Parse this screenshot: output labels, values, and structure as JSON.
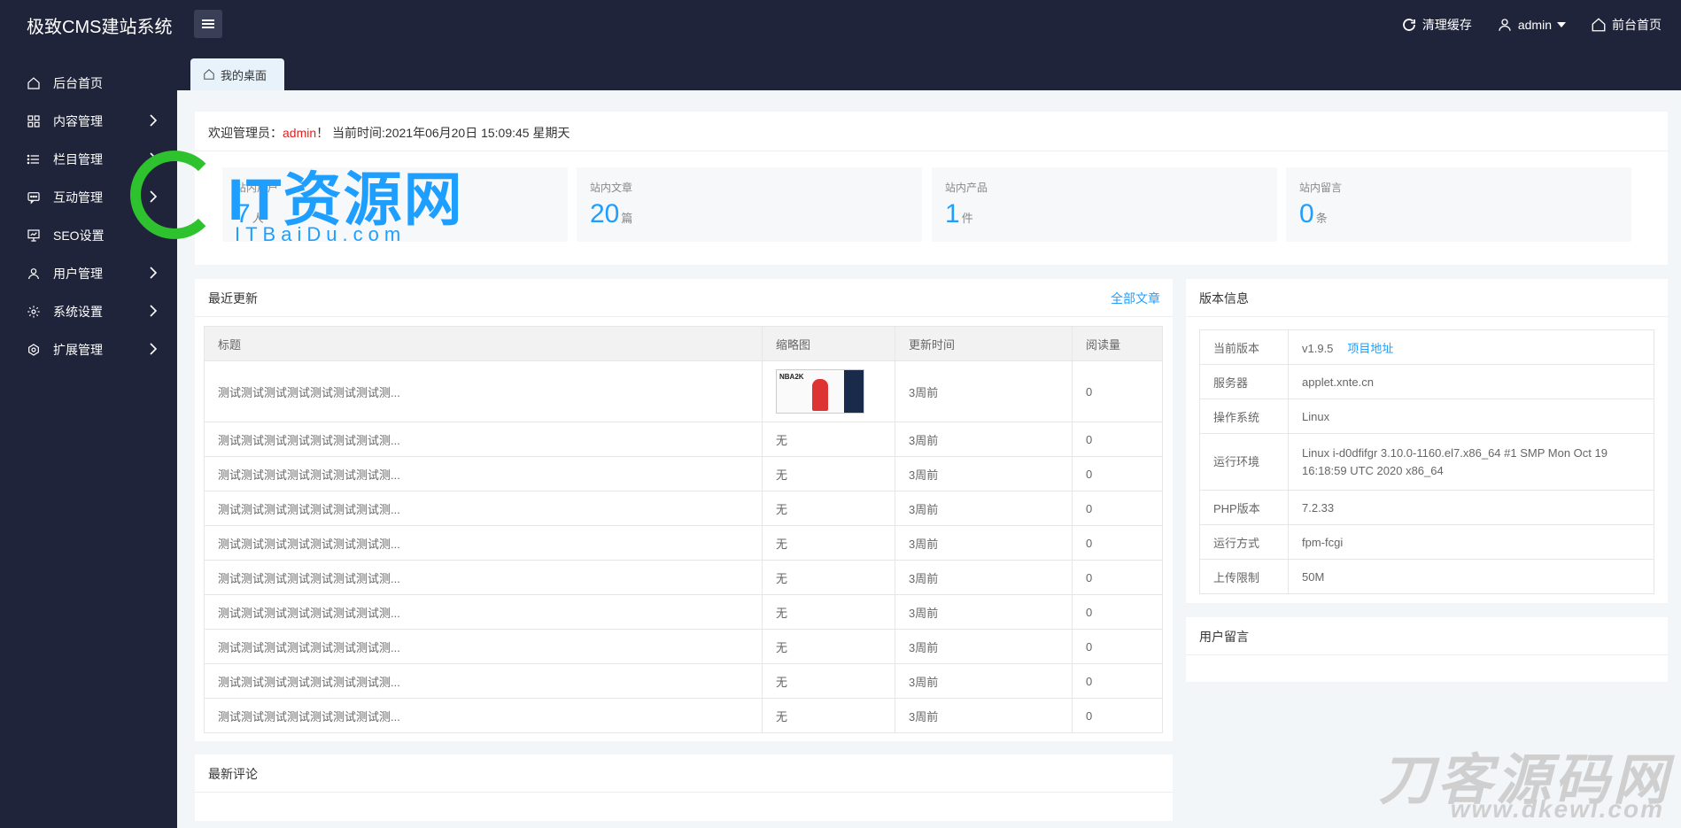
{
  "app": {
    "title": "极致CMS建站系统"
  },
  "header": {
    "clear_cache": "清理缓存",
    "user": "admin",
    "frontend": "前台首页"
  },
  "sidebar": {
    "items": [
      {
        "label": "后台首页",
        "icon": "home-icon",
        "has_children": false
      },
      {
        "label": "内容管理",
        "icon": "grid-icon",
        "has_children": true
      },
      {
        "label": "栏目管理",
        "icon": "list-icon",
        "has_children": true
      },
      {
        "label": "互动管理",
        "icon": "chat-icon",
        "has_children": true
      },
      {
        "label": "SEO设置",
        "icon": "seo-icon",
        "has_children": false
      },
      {
        "label": "用户管理",
        "icon": "user-icon",
        "has_children": true
      },
      {
        "label": "系统设置",
        "icon": "gear-icon",
        "has_children": true
      },
      {
        "label": "扩展管理",
        "icon": "extension-icon",
        "has_children": true
      }
    ]
  },
  "tabs": {
    "active": "我的桌面"
  },
  "welcome": {
    "prefix": "欢迎管理员：",
    "user": "admin",
    "suffix": "！ 当前时间:2021年06月20日 15:09:45 星期天"
  },
  "stats": [
    {
      "label": "站内用户",
      "value": "7",
      "unit": "人"
    },
    {
      "label": "站内文章",
      "value": "20",
      "unit": "篇"
    },
    {
      "label": "站内产品",
      "value": "1",
      "unit": "件"
    },
    {
      "label": "站内留言",
      "value": "0",
      "unit": "条"
    }
  ],
  "recent": {
    "title": "最近更新",
    "more": "全部文章",
    "columns": [
      "标题",
      "缩略图",
      "更新时间",
      "阅读量"
    ],
    "rows": [
      {
        "title": "测试测试测试测试测试测试测试测...",
        "thumb": "image",
        "time": "3周前",
        "views": "0"
      },
      {
        "title": "测试测试测试测试测试测试测试测...",
        "thumb": "无",
        "time": "3周前",
        "views": "0"
      },
      {
        "title": "测试测试测试测试测试测试测试测...",
        "thumb": "无",
        "time": "3周前",
        "views": "0"
      },
      {
        "title": "测试测试测试测试测试测试测试测...",
        "thumb": "无",
        "time": "3周前",
        "views": "0"
      },
      {
        "title": "测试测试测试测试测试测试测试测...",
        "thumb": "无",
        "time": "3周前",
        "views": "0"
      },
      {
        "title": "测试测试测试测试测试测试测试测...",
        "thumb": "无",
        "time": "3周前",
        "views": "0"
      },
      {
        "title": "测试测试测试测试测试测试测试测...",
        "thumb": "无",
        "time": "3周前",
        "views": "0"
      },
      {
        "title": "测试测试测试测试测试测试测试测...",
        "thumb": "无",
        "time": "3周前",
        "views": "0"
      },
      {
        "title": "测试测试测试测试测试测试测试测...",
        "thumb": "无",
        "time": "3周前",
        "views": "0"
      },
      {
        "title": "测试测试测试测试测试测试测试测...",
        "thumb": "无",
        "time": "3周前",
        "views": "0"
      }
    ]
  },
  "version": {
    "title": "版本信息",
    "link": "项目地址",
    "rows": [
      {
        "key": "当前版本",
        "value": "v1.9.5"
      },
      {
        "key": "服务器",
        "value": "applet.xnte.cn"
      },
      {
        "key": "操作系统",
        "value": "Linux"
      },
      {
        "key": "运行环境",
        "value": "Linux i-d0dfifgr 3.10.0-1160.el7.x86_64 #1 SMP Mon Oct 19 16:18:59 UTC 2020 x86_64"
      },
      {
        "key": "PHP版本",
        "value": "7.2.33"
      },
      {
        "key": "运行方式",
        "value": "fpm-fcgi"
      },
      {
        "key": "上传限制",
        "value": "50M"
      }
    ]
  },
  "messages": {
    "title": "用户留言"
  },
  "comments": {
    "title": "最新评论"
  },
  "watermarks": {
    "site1_name": "IT资源网",
    "site1_domain": "ITBaiDu.com",
    "site2_name": "刀客源码网",
    "site2_domain": "www.dkewl.com"
  },
  "colors": {
    "sidebar_bg": "#20243a",
    "accent": "#1e9fff",
    "admin_red": "#e02020",
    "content_bg": "#f2f6f9"
  }
}
